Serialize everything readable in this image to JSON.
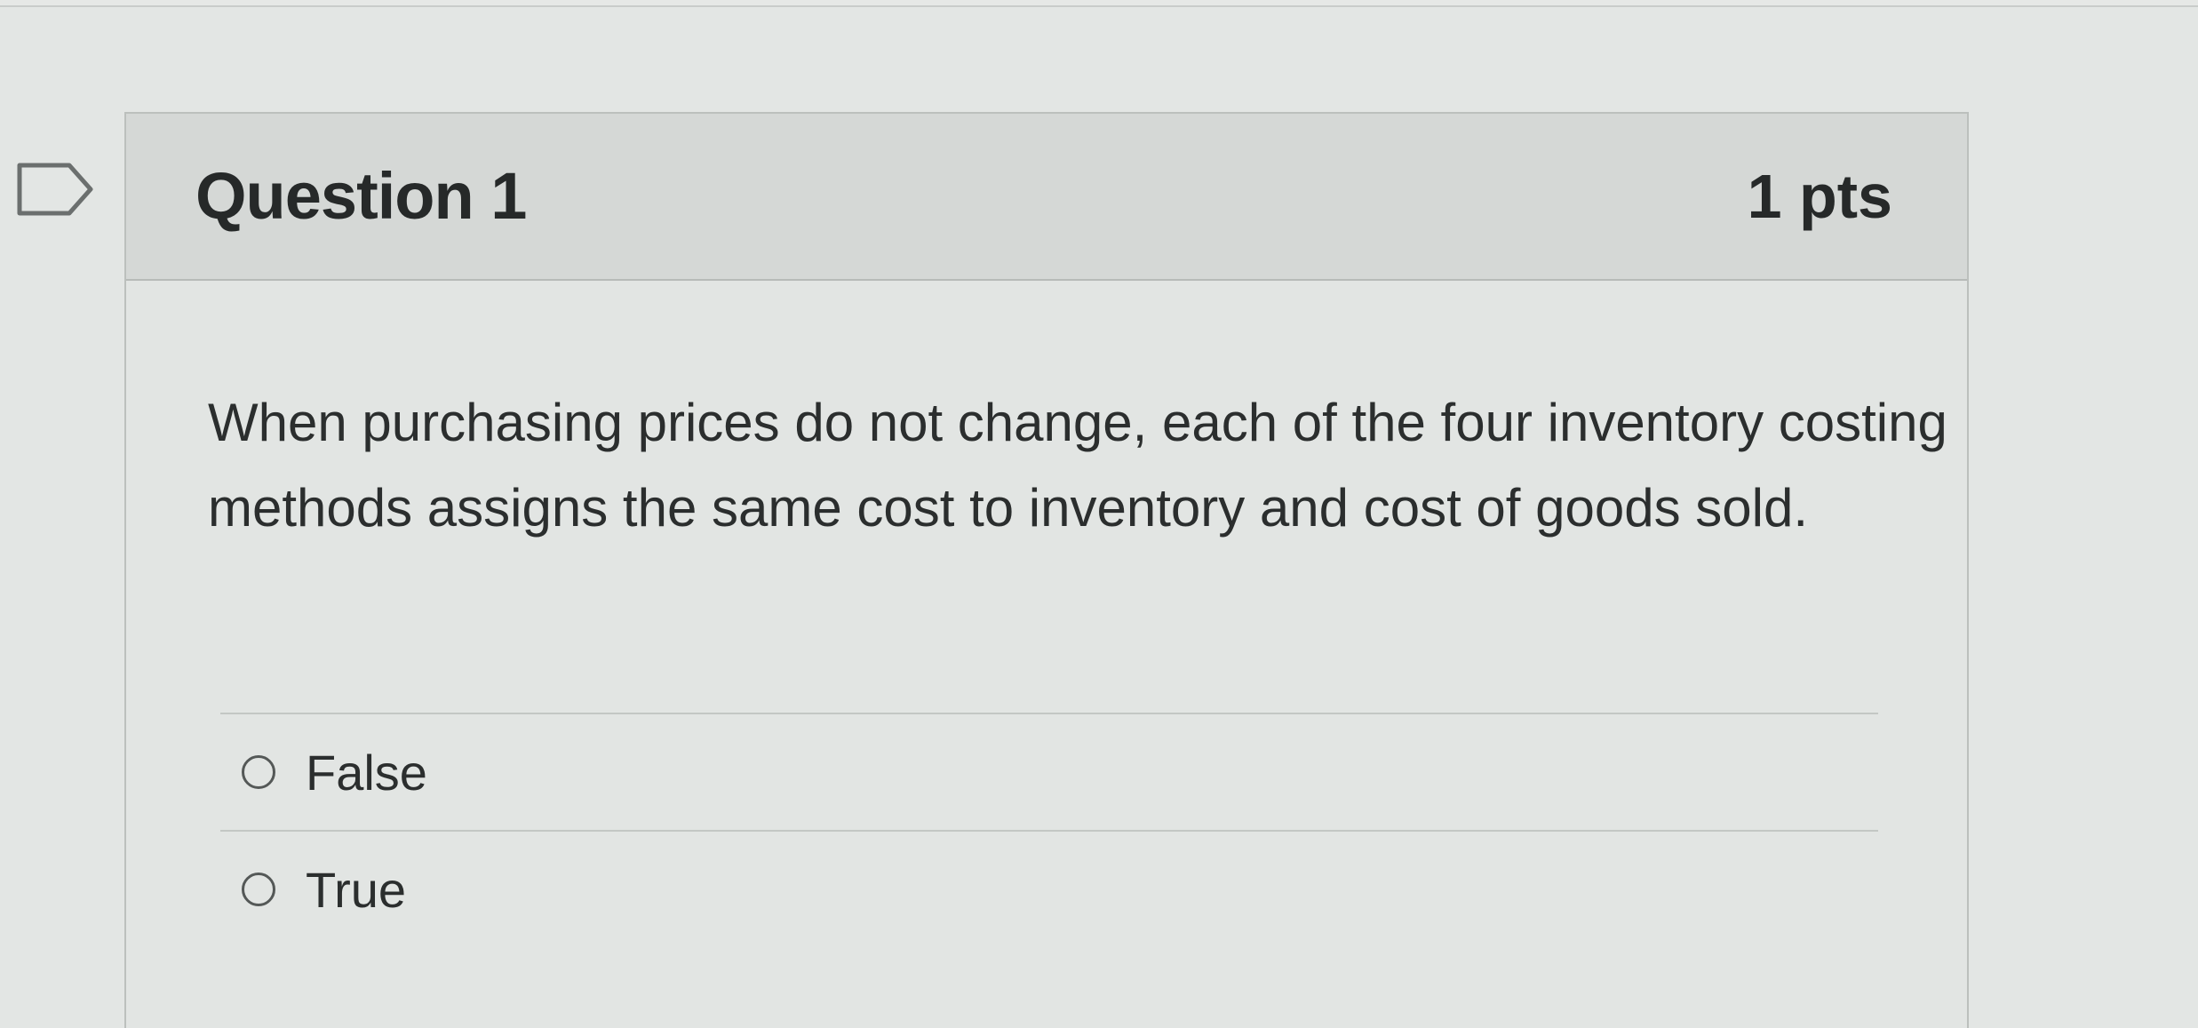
{
  "question": {
    "title": "Question 1",
    "points": "1 pts",
    "text": "When purchasing prices do not change, each of the four inventory costing methods assigns the same cost to inventory and cost of goods sold.",
    "flag_icon": "flag-outline-icon",
    "answers": [
      {
        "label": "False",
        "selected": false
      },
      {
        "label": "True",
        "selected": false
      }
    ]
  },
  "colors": {
    "background": "#e3e6e4",
    "header_background": "#d5d8d6",
    "text": "#262929"
  }
}
